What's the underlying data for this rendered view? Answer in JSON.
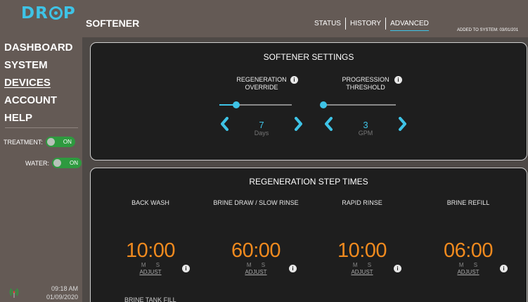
{
  "brand": {
    "logo_prefix": "DR",
    "logo_suffix": "P",
    "accent": "#3ec3e6"
  },
  "sidebar": {
    "nav": [
      {
        "label": "DASHBOARD",
        "active": false
      },
      {
        "label": "SYSTEM",
        "active": false
      },
      {
        "label": "DEVICES",
        "active": true
      },
      {
        "label": "ACCOUNT",
        "active": false
      },
      {
        "label": "HELP",
        "active": false
      }
    ],
    "toggles": [
      {
        "label": "TREATMENT:",
        "state": "ON",
        "on": true
      },
      {
        "label": "WATER:",
        "state": "ON",
        "on": true
      }
    ],
    "time": "09:18 AM",
    "date": "01/09/2020"
  },
  "header": {
    "title": "SOFTENER",
    "tabs": [
      {
        "label": "STATUS",
        "active": false
      },
      {
        "label": "HISTORY",
        "active": false
      },
      {
        "label": "ADVANCED",
        "active": true
      }
    ],
    "added_to_system": "ADDED TO SYSTEM: 03/01/201"
  },
  "settings_panel": {
    "title": "SOFTENER SETTINGS",
    "settings": [
      {
        "label_line1": "REGENERATION",
        "label_line2": "OVERRIDE",
        "value": "7",
        "unit": "Days",
        "slider_fraction": 0.23
      },
      {
        "label_line1": "PROGRESSION",
        "label_line2": "THRESHOLD",
        "value": "3",
        "unit": "GPM",
        "slider_fraction": 0.0
      }
    ]
  },
  "steps_panel": {
    "title": "REGENERATION STEP TIMES",
    "steps": [
      {
        "name": "BACK WASH",
        "time": "10:00",
        "ms": "M S",
        "adjust": "ADJUST"
      },
      {
        "name": "BRINE DRAW / SLOW RINSE",
        "time": "60:00",
        "ms": "M S",
        "adjust": "ADJUST"
      },
      {
        "name": "RAPID RINSE",
        "time": "10:00",
        "ms": "M S",
        "adjust": "ADJUST"
      },
      {
        "name": "BRINE REFILL",
        "time": "06:00",
        "ms": "M S",
        "adjust": "ADJUST"
      }
    ],
    "partial_label": "BRINE TANK FILL"
  },
  "colors": {
    "time_orange": "#f08a1e",
    "toggle_green": "#2e9a3f"
  }
}
